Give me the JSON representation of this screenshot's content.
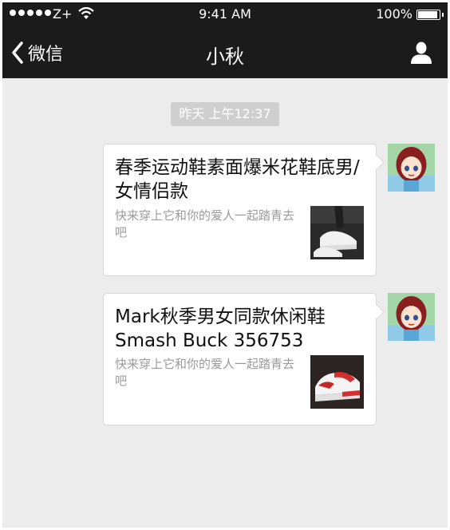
{
  "status_bar": {
    "carrier": "Z+",
    "time": "9:41 AM",
    "battery_percent_text": "100%",
    "battery_level": 1.0
  },
  "nav": {
    "back_label": "微信",
    "title": "小秋",
    "back_icon": "chevron-left-icon",
    "profile_icon": "person-icon"
  },
  "chat": {
    "timestamp": "昨天 上午12:37",
    "messages": [
      {
        "title": "春季运动鞋素面爆米花鞋底男/女情侣款",
        "description": "快来穿上它和你的爱人一起踏青去吧",
        "thumbnail": "white-sneaker-photo",
        "avatar": "cartoon-girl-avatar"
      },
      {
        "title": "Mark秋季男女同款休闲鞋Smash Buck 356753",
        "description": "快来穿上它和你的爱人一起踏青去吧",
        "thumbnail": "red-white-sneaker-photo",
        "avatar": "cartoon-girl-avatar"
      }
    ]
  },
  "colors": {
    "nav_background": "#1b1b1b",
    "chat_background": "#ececec",
    "timestamp_background": "#cfcfcf",
    "card_background": "#ffffff",
    "description_text": "#9a9a9a"
  }
}
